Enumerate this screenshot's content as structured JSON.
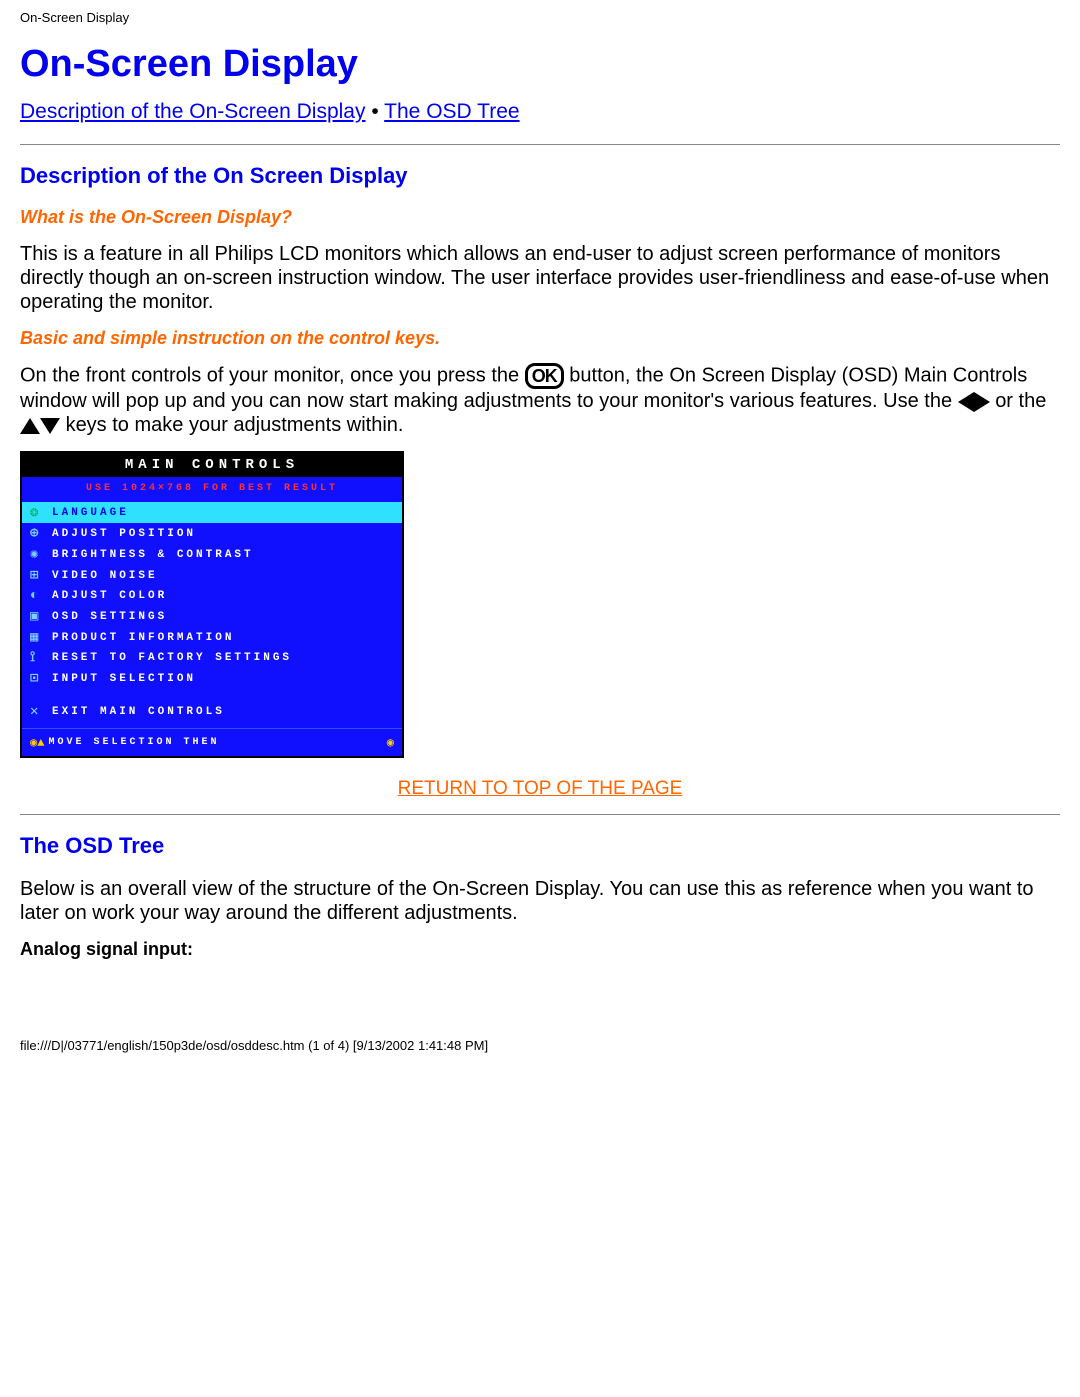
{
  "header_small": "On-Screen Display",
  "title": "On-Screen Display",
  "toc": {
    "link1": "Description of the On-Screen Display",
    "bullet": "•",
    "link2": "The OSD Tree"
  },
  "section1": {
    "heading": "Description of the On Screen Display",
    "q": "What is the On-Screen Display?",
    "p1": "This is a feature in all Philips LCD monitors which allows an end-user to adjust screen performance of monitors directly though an on-screen instruction window. The user interface provides user-friendliness and ease-of-use when operating the monitor.",
    "sub": "Basic and simple instruction on the control keys.",
    "p2a": "On the front controls of your monitor, once you press the ",
    "p2b": " button, the On Screen Display (OSD) Main Controls window will pop up and you can now start making adjustments to your monitor's various features. Use the ",
    "p2c": " or the ",
    "p2d": " keys to make your adjustments within."
  },
  "osd": {
    "title": "MAIN CONTROLS",
    "notice": "USE 1024×768 FOR BEST RESULT",
    "items": [
      {
        "icon": "❂",
        "label": "LANGUAGE",
        "selected": true
      },
      {
        "icon": "⊕",
        "label": "ADJUST POSITION"
      },
      {
        "icon": "✺",
        "label": "BRIGHTNESS & CONTRAST"
      },
      {
        "icon": "⊞",
        "label": "VIDEO NOISE"
      },
      {
        "icon": "◐",
        "label": "ADJUST COLOR"
      },
      {
        "icon": "▣",
        "label": "OSD SETTINGS"
      },
      {
        "icon": "▦",
        "label": "PRODUCT INFORMATION"
      },
      {
        "icon": "⟟",
        "label": "RESET TO FACTORY SETTINGS"
      },
      {
        "icon": "⊡",
        "label": "INPUT SELECTION"
      },
      {
        "icon": "✕",
        "label": "EXIT MAIN CONTROLS",
        "exit": true
      }
    ],
    "footer_icons": "◉▲",
    "footer_text": "MOVE SELECTION THEN",
    "footer_right": "◉"
  },
  "return_top": "RETURN TO TOP OF THE PAGE",
  "section2": {
    "heading": "The OSD Tree",
    "p1": "Below is an overall view of the structure of the On-Screen Display. You can use this as reference when you want to later on work your way around the different adjustments.",
    "sub": "Analog signal input:"
  },
  "footer": "file:///D|/03771/english/150p3de/osd/osddesc.htm (1 of 4) [9/13/2002 1:41:48 PM]"
}
